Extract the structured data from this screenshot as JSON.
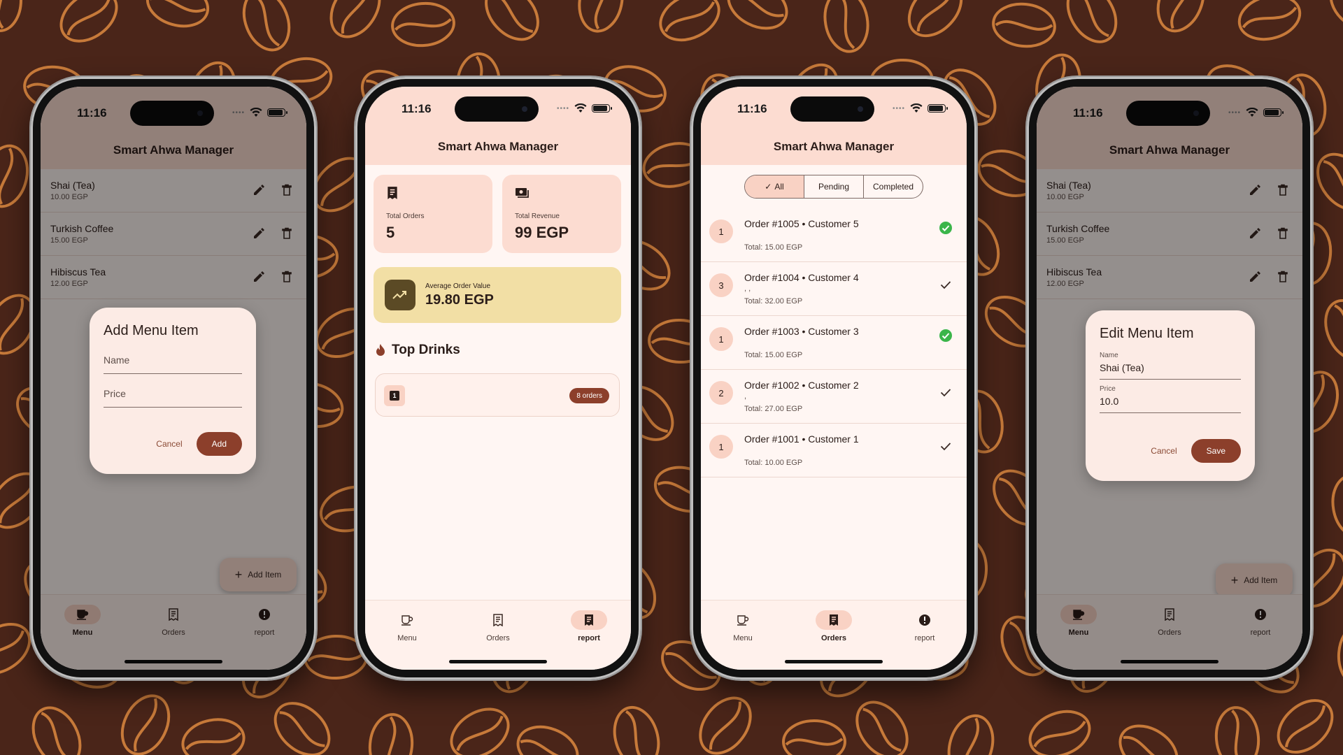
{
  "colors": {
    "background": "#4a2519",
    "bean_outline": "#c77a3a",
    "primary": "#8c3f2b",
    "app_bar": "#fcdcd1",
    "card_orders": "#fcdcd1",
    "card_avg": "#f2dfa5",
    "completed_green": "#3bb54a"
  },
  "status_bar": {
    "time": "11:16"
  },
  "app": {
    "title": "Smart Ahwa Manager"
  },
  "nav": [
    {
      "label": "Menu",
      "icon": "coffee-cup-icon"
    },
    {
      "label": "Orders",
      "icon": "receipt-icon"
    },
    {
      "label": "report",
      "icon": "alert-circle-icon"
    }
  ],
  "menu": {
    "items": [
      {
        "name": "Shai (Tea)",
        "price": "10.00 EGP"
      },
      {
        "name": "Turkish Coffee",
        "price": "15.00 EGP"
      },
      {
        "name": "Hibiscus Tea",
        "price": "12.00 EGP"
      }
    ],
    "fab_label": "Add Item"
  },
  "add_dialog": {
    "title": "Add Menu Item",
    "name_placeholder": "Name",
    "price_placeholder": "Price",
    "cancel": "Cancel",
    "confirm": "Add"
  },
  "edit_dialog": {
    "title": "Edit Menu Item",
    "name_label": "Name",
    "name_value": "Shai (Tea)",
    "price_label": "Price",
    "price_value": "10.0",
    "cancel": "Cancel",
    "confirm": "Save"
  },
  "report": {
    "total_orders_label": "Total Orders",
    "total_orders_value": "5",
    "total_revenue_label": "Total Revenue",
    "total_revenue_value": "99 EGP",
    "avg_label": "Average Order Value",
    "avg_value": "19.80 EGP",
    "top_drinks_title": "Top Drinks",
    "top_drink_rank": "1",
    "top_drink_badge": "8 orders"
  },
  "orders": {
    "filters": [
      "All",
      "Pending",
      "Completed"
    ],
    "selected_filter": "All",
    "list": [
      {
        "qty": "1",
        "title": "Order #1005 • Customer 5",
        "extra": "",
        "total": "Total: 15.00 EGP",
        "status": "completed"
      },
      {
        "qty": "3",
        "title": "Order #1004 • Customer 4",
        "extra": ", ,",
        "total": "Total: 32.00 EGP",
        "status": "pending"
      },
      {
        "qty": "1",
        "title": "Order #1003 • Customer 3",
        "extra": "",
        "total": "Total: 15.00 EGP",
        "status": "completed"
      },
      {
        "qty": "2",
        "title": "Order #1002 • Customer 2",
        "extra": ",",
        "total": "Total: 27.00 EGP",
        "status": "pending"
      },
      {
        "qty": "1",
        "title": "Order #1001 • Customer 1",
        "extra": "",
        "total": "Total: 10.00 EGP",
        "status": "pending"
      }
    ]
  }
}
